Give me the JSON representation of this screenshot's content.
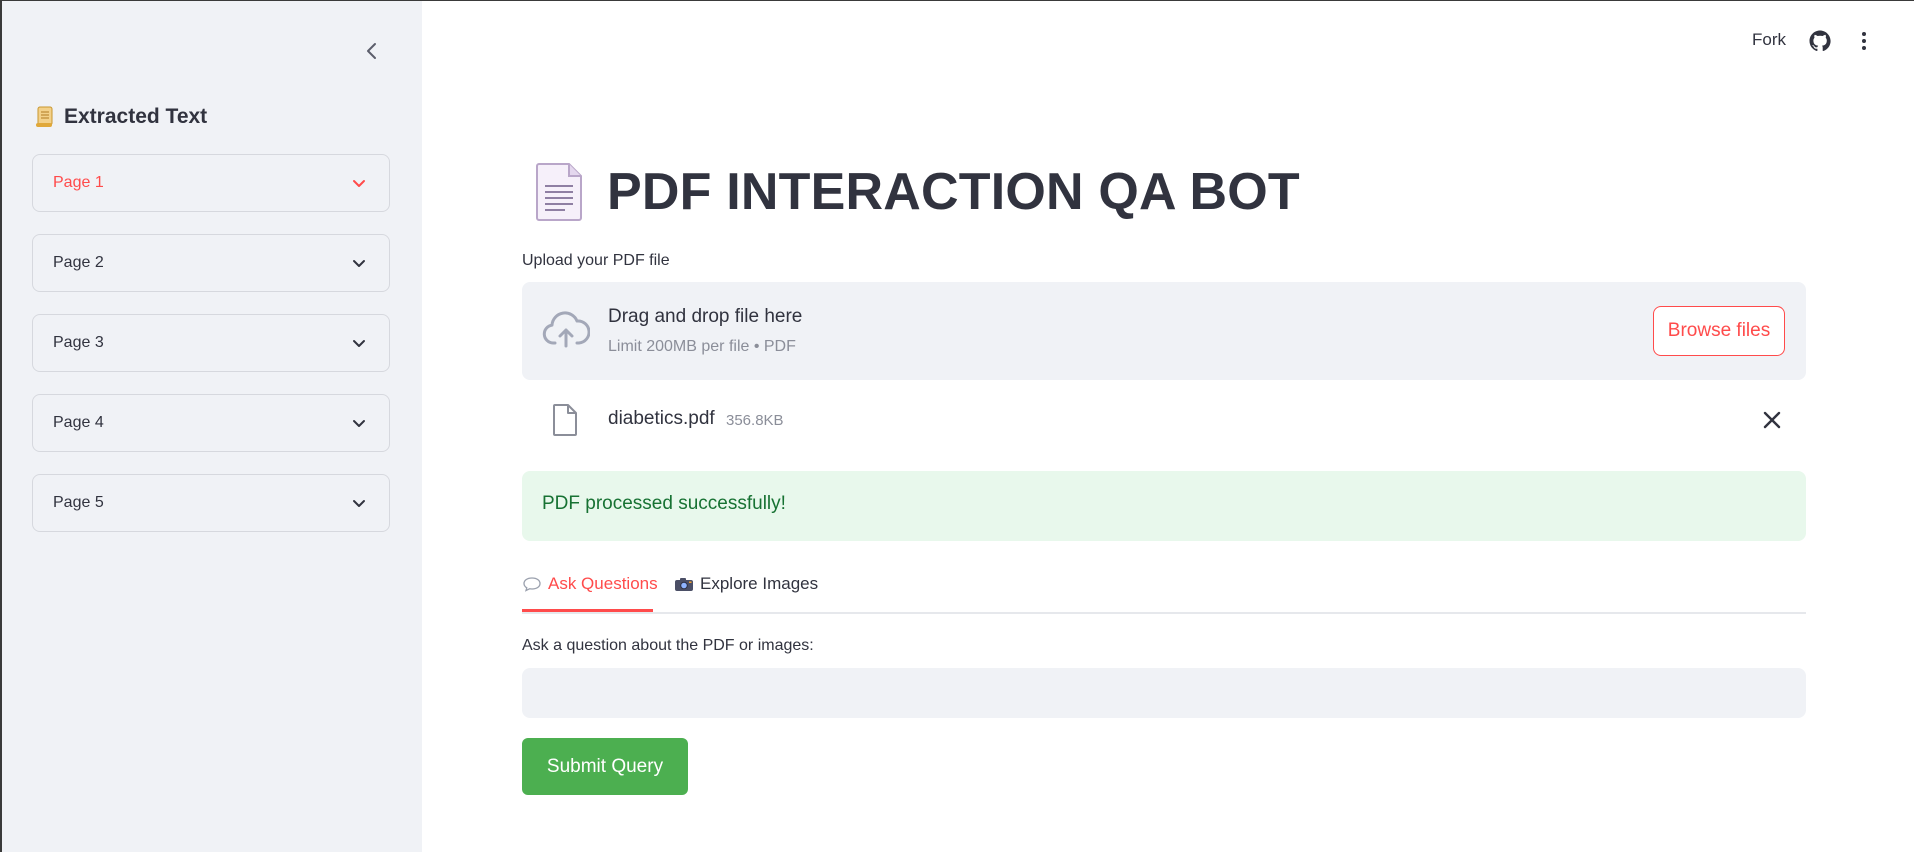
{
  "header": {
    "fork_label": "Fork",
    "github_icon": "github-icon",
    "menu_icon": "kebab-menu-icon"
  },
  "sidebar": {
    "collapse_icon": "chevron-left-icon",
    "title_emoji_icon": "scroll-icon",
    "title": "Extracted Text",
    "expanders": [
      {
        "label": "Page 1",
        "active": true
      },
      {
        "label": "Page 2"
      },
      {
        "label": "Page 3"
      },
      {
        "label": "Page 4"
      },
      {
        "label": "Page 5"
      }
    ]
  },
  "main": {
    "title_icon": "document-icon",
    "title": "PDF INTERACTION QA BOT",
    "upload": {
      "label": "Upload your PDF file",
      "drop_text": "Drag and drop file here",
      "limit_text": "Limit 200MB per file • PDF",
      "browse_label": "Browse files"
    },
    "file": {
      "name": "diabetics.pdf",
      "size": "356.8KB"
    },
    "success_message": "PDF processed successfully!",
    "tabs": [
      {
        "icon": "speech-bubble-icon",
        "label": "Ask Questions",
        "active": true
      },
      {
        "icon": "camera-icon",
        "label": "Explore Images"
      }
    ],
    "question": {
      "label": "Ask a question about the PDF or images:",
      "value": "",
      "placeholder": ""
    },
    "submit_label": "Submit Query"
  },
  "colors": {
    "accent": "#ff4b4b",
    "success_bg": "#e8f8ec",
    "success_text": "#177233",
    "submit_bg": "#4caf50",
    "sidebar_bg": "#f0f2f6"
  }
}
